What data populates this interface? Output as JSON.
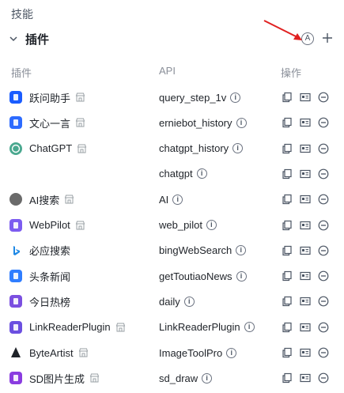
{
  "section": {
    "title": "技能"
  },
  "group": {
    "title": "插件",
    "auto_icon_text": "A",
    "add_label": "+"
  },
  "columns": {
    "plugin": "插件",
    "api": "API",
    "actions": "操作"
  },
  "colors": {
    "arrow": "#e02020",
    "text": "#1f2329",
    "muted": "#8a8f99",
    "icon": "#6b7280"
  },
  "rows": [
    {
      "plugin": "跃问助手",
      "api": "query_step_1v",
      "logo": "#1a5cff",
      "logo_icon": "stepfun-logo",
      "store": true
    },
    {
      "plugin": "文心一言",
      "api": "erniebot_history",
      "logo": "#2d6bff",
      "logo_icon": "ernie-logo",
      "store": true
    },
    {
      "plugin": "ChatGPT",
      "api": "chatgpt_history",
      "logo": "#4aa88f",
      "logo_icon": "openai-logo",
      "store": true
    },
    {
      "plugin": "",
      "api": "chatgpt",
      "logo": "",
      "logo_icon": "",
      "store": false
    },
    {
      "plugin": "AI搜索",
      "api": "AI",
      "logo": "#6a6a6a",
      "logo_icon": "ai-search-logo",
      "store": true
    },
    {
      "plugin": "WebPilot",
      "api": "web_pilot",
      "logo": "#7c5cf0",
      "logo_icon": "webpilot-logo",
      "store": true
    },
    {
      "plugin": "必应搜索",
      "api": "bingWebSearch",
      "logo": "#ffffff",
      "logo_icon": "bing-logo",
      "store": false
    },
    {
      "plugin": "头条新闻",
      "api": "getToutiaoNews",
      "logo": "#2f7dff",
      "logo_icon": "toutiao-logo",
      "store": false
    },
    {
      "plugin": "今日热榜",
      "api": "daily",
      "logo": "#7b4fe0",
      "logo_icon": "hotlist-logo",
      "store": false
    },
    {
      "plugin": "LinkReaderPlugin",
      "api": "LinkReaderPlugin",
      "logo": "#6b4fe0",
      "logo_icon": "linkreader-logo",
      "store": true
    },
    {
      "plugin": "ByteArtist",
      "api": "ImageToolPro",
      "logo": "#1f2329",
      "logo_icon": "byteartist-logo",
      "store": true
    },
    {
      "plugin": "SD图片生成",
      "api": "sd_draw",
      "logo": "#8a3ce0",
      "logo_icon": "sd-logo",
      "store": true
    }
  ]
}
